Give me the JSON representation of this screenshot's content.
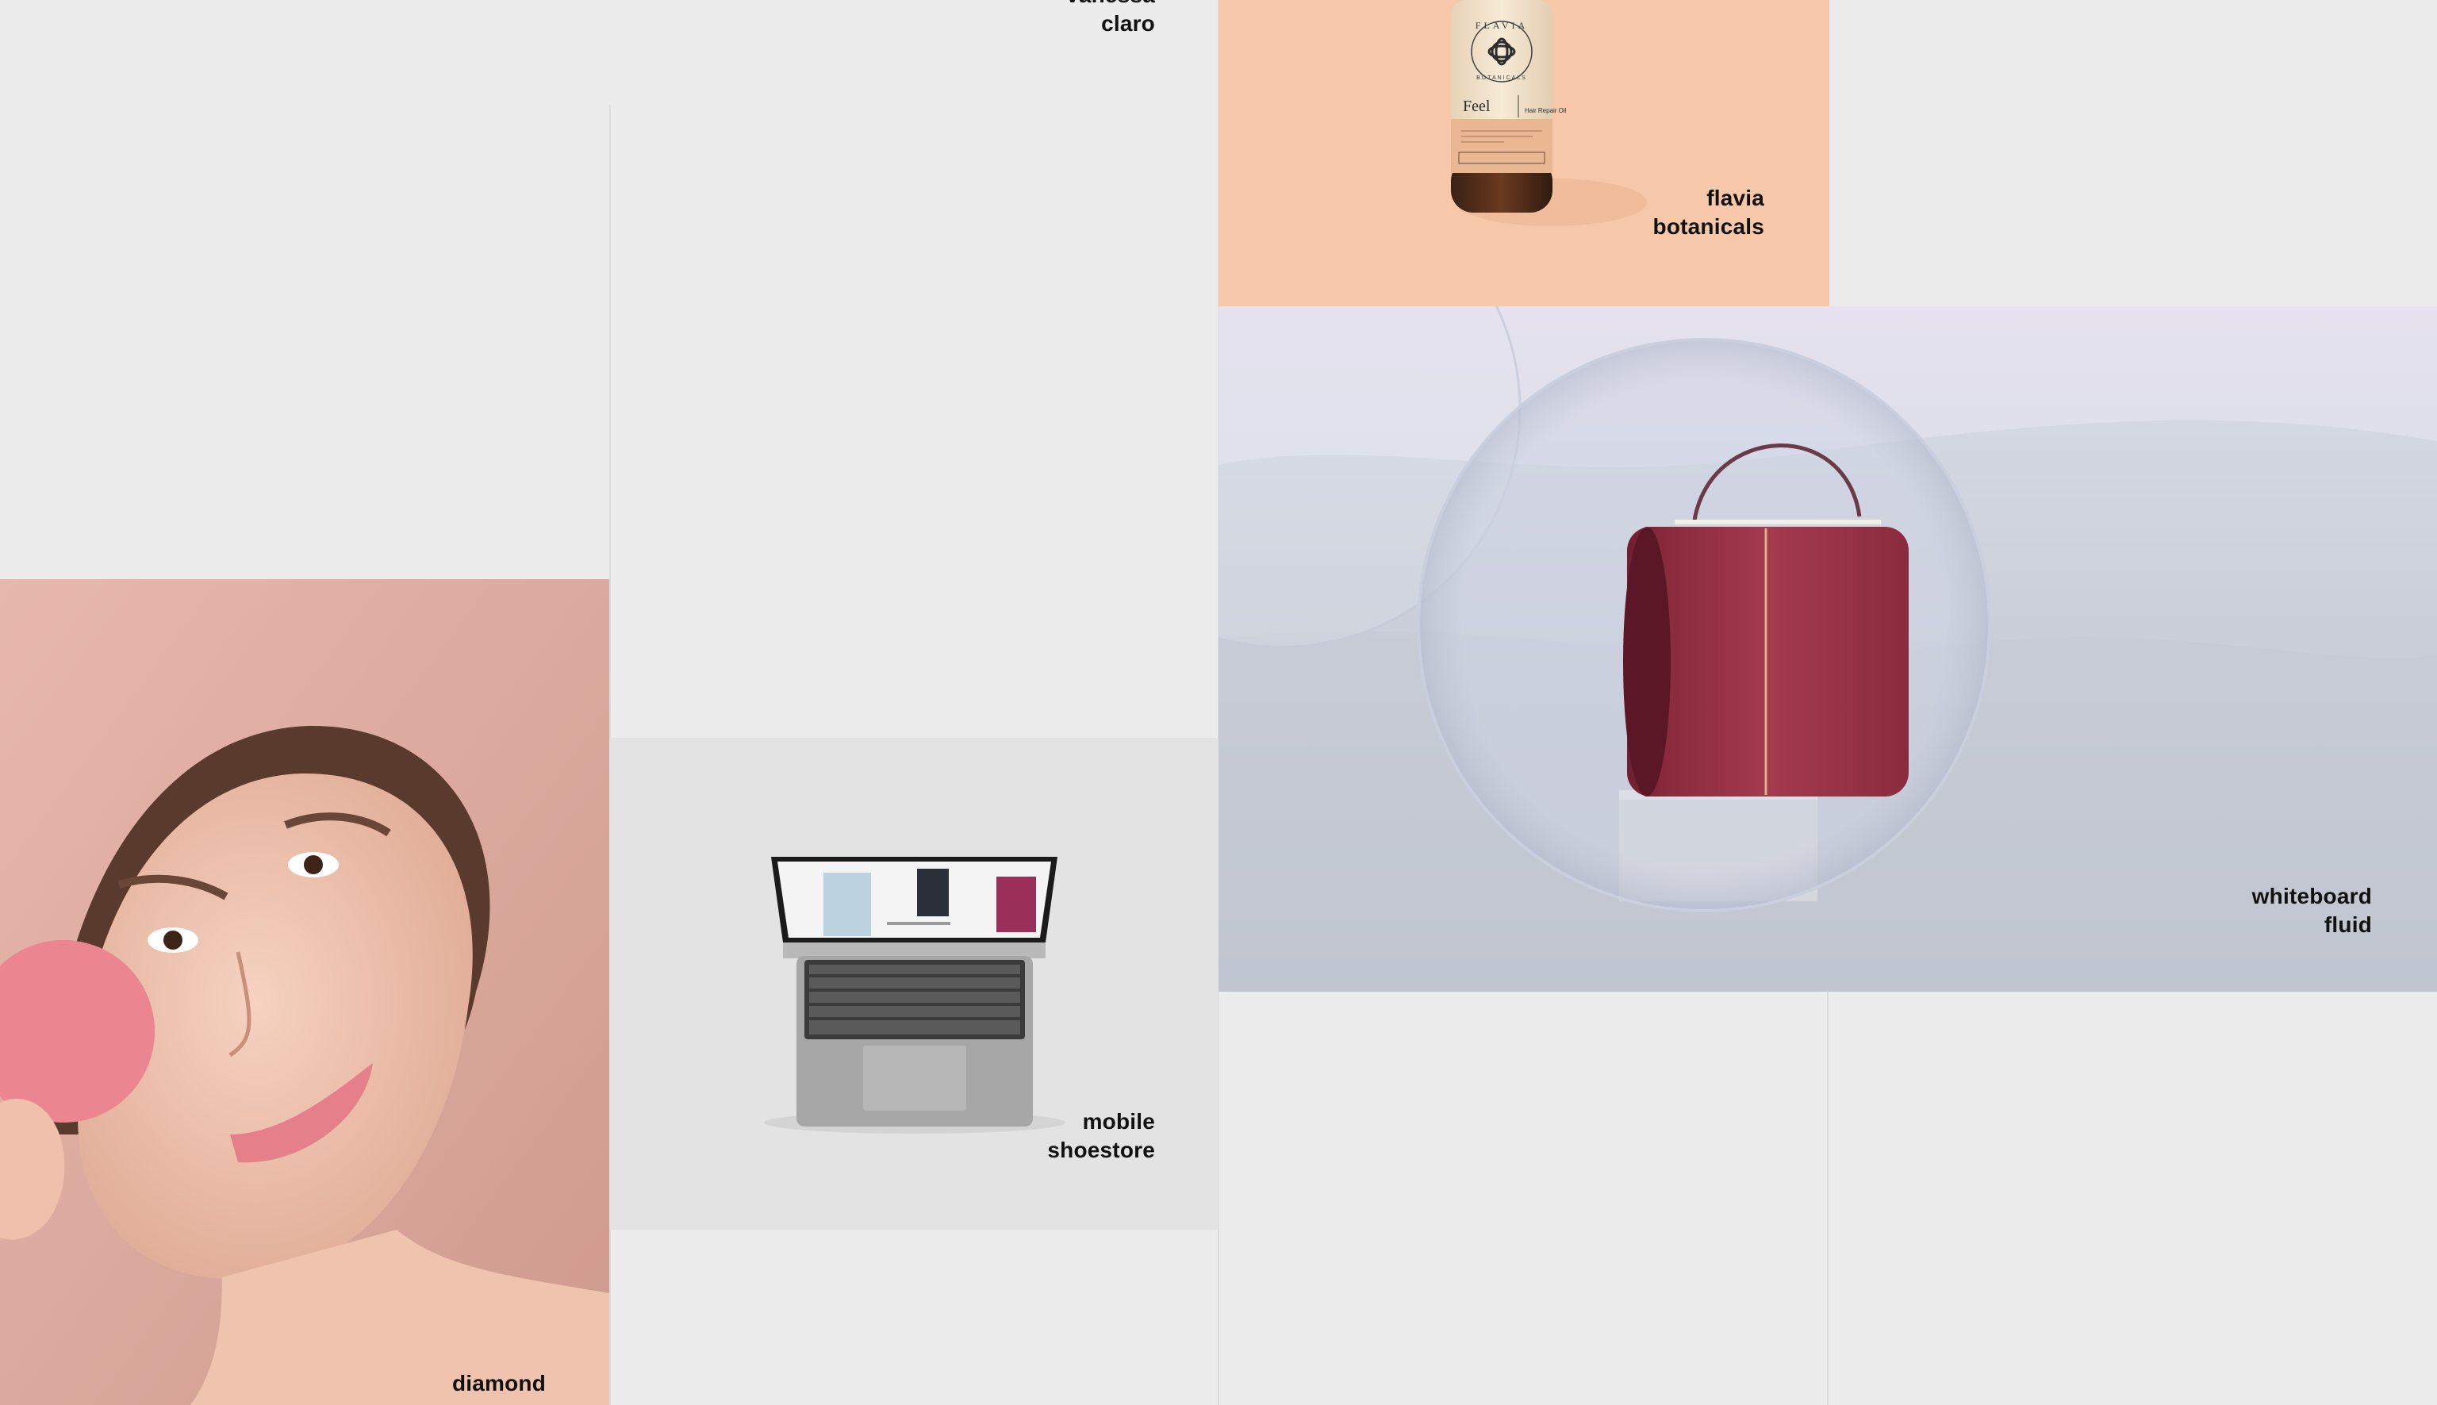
{
  "projects": {
    "vanessa_claro": {
      "line1": "vanessa",
      "line2": "claro"
    },
    "flavia_botanicals": {
      "line1": "flavia",
      "line2": "botanicals",
      "bottle": {
        "brand": "FLAVIA",
        "sub": "BOTANICALS",
        "product": "Feel",
        "variant": "Hair Repair Oil"
      }
    },
    "whiteboard_fluid": {
      "line1": "whiteboard",
      "line2": "fluid"
    },
    "mobile_shoestore": {
      "line1": "mobile",
      "line2": "shoestore"
    },
    "diamond": {
      "line1": "diamond"
    }
  },
  "colors": {
    "page_bg": "#ececec",
    "peach": "#f6c8a9",
    "blush": "#dcaaa0",
    "grey_tile": "#e3e3e3",
    "sand": "#d8dce6",
    "bag_red": "#9a3244"
  }
}
